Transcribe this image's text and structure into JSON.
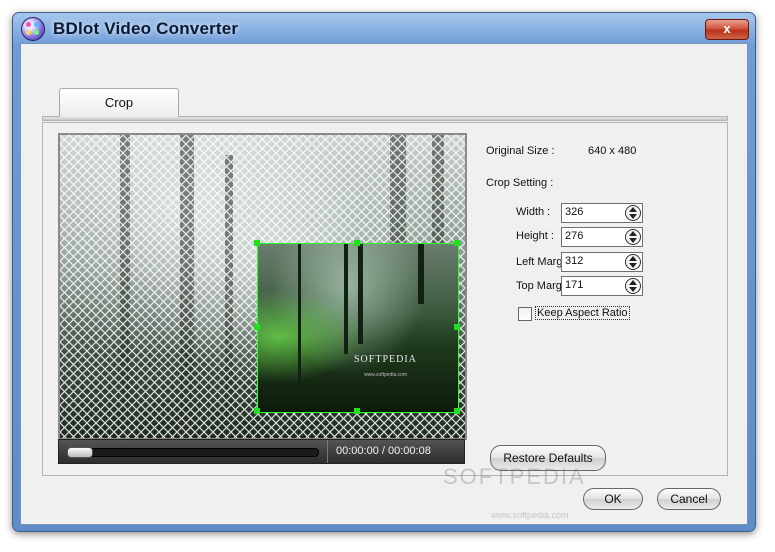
{
  "window": {
    "title": "BDlot Video Converter",
    "close_symbol": "x"
  },
  "tabs": [
    {
      "label": "Crop",
      "active": true
    }
  ],
  "preview": {
    "watermark": "SOFTPEDIA",
    "watermark_sub": "www.softpedia.com",
    "time": "00:00:00 / 00:00:08",
    "seek_progress": 0
  },
  "info": {
    "original_size_label": "Original Size :",
    "original_size_value": "640 x 480",
    "crop_setting_label": "Crop Setting :"
  },
  "crop": {
    "width_label": "Width :",
    "width_value": "326",
    "height_label": "Height :",
    "height_value": "276",
    "left_margin_label": "Left Margin :",
    "left_margin_value": "312",
    "top_margin_label": "Top Margin :",
    "top_margin_value": "171",
    "keep_aspect_label": "Keep Aspect Ratio",
    "keep_aspect_checked": false
  },
  "buttons": {
    "restore_defaults": "Restore Defaults",
    "ok": "OK",
    "cancel": "Cancel"
  },
  "page_watermark": {
    "text": "SOFTPEDIA",
    "sub": "www.softpedia.com"
  },
  "colors": {
    "crop_border": "#2bff2b",
    "handle": "#1fe01f",
    "title_bar": "#7fa9df"
  }
}
